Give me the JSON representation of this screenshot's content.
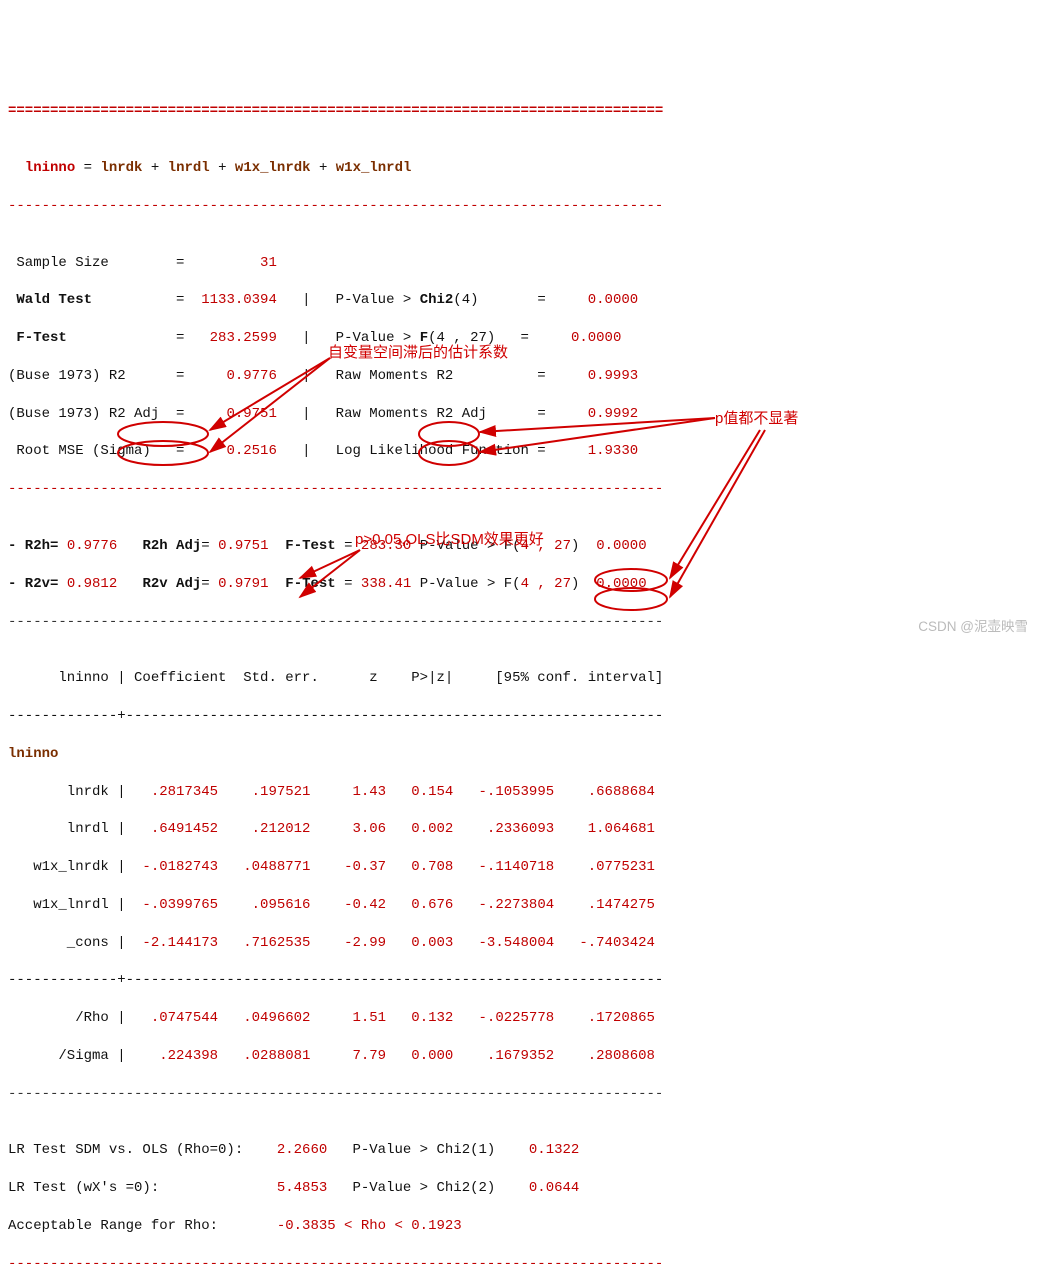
{
  "rules": {
    "eq": "==============================================================================",
    "dash": "------------------------------------------------------------------------------"
  },
  "equation": {
    "lhs": "lninno",
    "eq": " = ",
    "t1": "lnrdk",
    "plus": " + ",
    "t2": "lnrdl",
    "t3": "w1x_lnrdk",
    "t4": "w1x_lnrdl"
  },
  "summary": {
    "r1": {
      "label": " Sample Size        =         ",
      "val": "31"
    },
    "r2": {
      "label": " Wald Test",
      "mid": "          =  ",
      "val": "1133.0394",
      "sep": "   |   ",
      "pl": "P-Value > ",
      "stat": "Chi2",
      "args": "(4)",
      "tail": "       =     ",
      "pv": "0.0000"
    },
    "r3": {
      "label": " F-Test",
      "mid": "             =   ",
      "val": "283.2599",
      "sep": "   |   ",
      "pl": "P-Value > ",
      "stat": "F",
      "args": "(4 , 27)",
      "tail": "   =     ",
      "pv": "0.0000"
    },
    "r4": {
      "label": "(Buse 1973) R2      =     ",
      "val": "0.9776",
      "sep": "   |   ",
      "rm": "Raw Moments R2",
      "tail": "          =     ",
      "rv": "0.9993"
    },
    "r5": {
      "label": "(Buse 1973) R2 Adj  =     ",
      "val": "0.9751",
      "sep": "   |   ",
      "rm": "Raw Moments R2 Adj",
      "tail": "      =     ",
      "rv": "0.9992"
    },
    "r6": {
      "label": " Root MSE (Sigma)   =     ",
      "val": "0.2516",
      "sep": "   |   ",
      "rm": "Log Likelihood Function =     ",
      "rv": "1.9330"
    }
  },
  "rblock": {
    "r1": {
      "a": "- R2h= ",
      "av": "0.9776",
      "b": "   R2h Adj",
      "c": "= ",
      "cv": "0.9751",
      "d": "  F-Test",
      "e": " = ",
      "ev": "283.30",
      "f": " P-Value > F(",
      "g": "4 , 27",
      "h": ")  ",
      "hv": "0.0000"
    },
    "r2": {
      "a": "- R2v= ",
      "av": "0.9812",
      "b": "   R2v Adj",
      "c": "= ",
      "cv": "0.9791",
      "d": "  F-Test",
      "e": " = ",
      "ev": "338.41",
      "f": " P-Value > F(",
      "g": "4 , 27",
      "h": ")  ",
      "hv": "0.0000"
    }
  },
  "table": {
    "header": "      lninno | Coefficient  Std. err.      z    P>|z|     [95% conf. interval]",
    "sep": "-------------+----------------------------------------------------------------"
  },
  "coeffs": {
    "sec": "lninno",
    "r1": {
      "n": "       lnrdk |",
      "c": "   .2817345",
      "s": "    .197521",
      "z": "     1.43",
      "p": "   0.154",
      "lo": "   -.1053995",
      "hi": "    .6688684"
    },
    "r2": {
      "n": "       lnrdl |",
      "c": "   .6491452",
      "s": "    .212012",
      "z": "     3.06",
      "p": "   0.002",
      "lo": "    .2336093",
      "hi": "    1.064681"
    },
    "r3": {
      "n": "   w1x_lnrdk |",
      "c": "  -.0182743",
      "s": "   .0488771",
      "z": "    -0.37",
      "p": "   0.708",
      "lo": "   -.1140718",
      "hi": "    .0775231"
    },
    "r4": {
      "n": "   w1x_lnrdl |",
      "c": "  -.0399765",
      "s": "    .095616",
      "z": "    -0.42",
      "p": "   0.676",
      "lo": "   -.2273804",
      "hi": "    .1474275"
    },
    "r5": {
      "n": "       _cons |",
      "c": "  -2.144173",
      "s": "   .7162535",
      "z": "    -2.99",
      "p": "   0.003",
      "lo": "   -3.548004",
      "hi": "   -.7403424"
    },
    "r6": {
      "n": "        /Rho |",
      "c": "   .0747544",
      "s": "   .0496602",
      "z": "     1.51",
      "p": "   0.132",
      "lo": "   -.0225778",
      "hi": "    .1720865"
    },
    "r7": {
      "n": "      /Sigma |",
      "c": "    .224398",
      "s": "   .0288081",
      "z": "     7.79",
      "p": "   0.000",
      "lo": "    .1679352",
      "hi": "    .2808608"
    }
  },
  "footer": {
    "r1": {
      "l": "LR Test SDM vs. OLS (Rho=0):    ",
      "v": "2.2660",
      "m": "   P-Value > Chi2(1)    ",
      "p": "0.1322"
    },
    "r2": {
      "l": "LR Test (wX's =0):              ",
      "v": "5.4853",
      "m": "   P-Value > Chi2(2)    ",
      "p": "0.0644"
    },
    "r3": {
      "l": "Acceptable Range for Rho:       ",
      "rng": "-0.3835 < Rho < 0.1923"
    }
  },
  "annotations": {
    "a1": "自变量空间滞后的估计系数",
    "a2": "p值都不显著",
    "a3": "p>0.05,OLS比SDM效果更好"
  },
  "watermark": "CSDN @泥壶映雪"
}
